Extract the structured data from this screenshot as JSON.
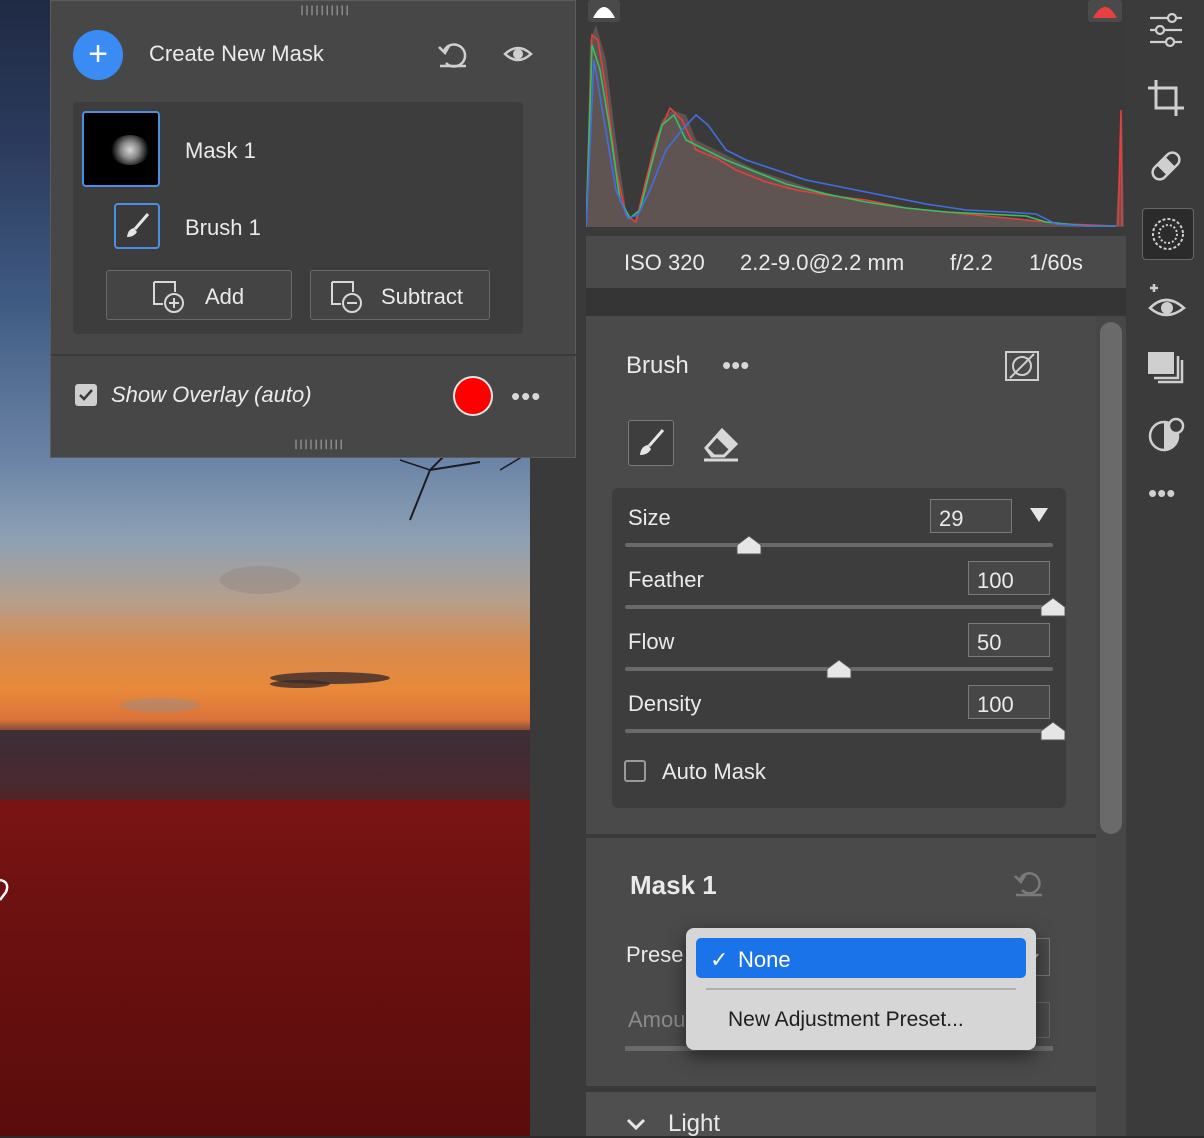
{
  "mask_panel": {
    "create_label": "Create New Mask",
    "create_symbol": "+",
    "mask_name": "Mask 1",
    "brush_name": "Brush 1",
    "add_label": "Add",
    "subtract_label": "Subtract",
    "overlay_label": "Show Overlay (auto)",
    "overlay_checked": true,
    "overlay_color": "#ff0000",
    "more_symbol": "•••"
  },
  "histogram": {
    "info": {
      "iso": "ISO 320",
      "lens": "2.2-9.0@2.2 mm",
      "aperture": "f/2.2",
      "shutter": "1/60s"
    }
  },
  "brush": {
    "title": "Brush",
    "more_symbol": "•••",
    "sliders": [
      {
        "label": "Size",
        "value": "29",
        "level": 0.29
      },
      {
        "label": "Feather",
        "value": "100",
        "level": 1.0
      },
      {
        "label": "Flow",
        "value": "50",
        "level": 0.5
      },
      {
        "label": "Density",
        "value": "100",
        "level": 1.0
      }
    ],
    "auto_mask_label": "Auto Mask",
    "auto_mask_checked": false
  },
  "mask_section": {
    "title": "Mask 1",
    "preset_label": "Prese",
    "amount_label": "Amou"
  },
  "dropdown": {
    "check": "✓",
    "selected": "None",
    "option2": "New Adjustment Preset..."
  },
  "light_section": {
    "label": "Light"
  },
  "toolbar": {
    "more_symbol": "•••",
    "tools": [
      "sliders-icon",
      "crop-icon",
      "healing-icon",
      "masking-icon",
      "redeye-icon",
      "presets-icon",
      "snapshot-icon"
    ]
  },
  "colors": {
    "accent": "#3b8bf5",
    "selection": "#1a73e8",
    "overlay": "#ff0000"
  }
}
